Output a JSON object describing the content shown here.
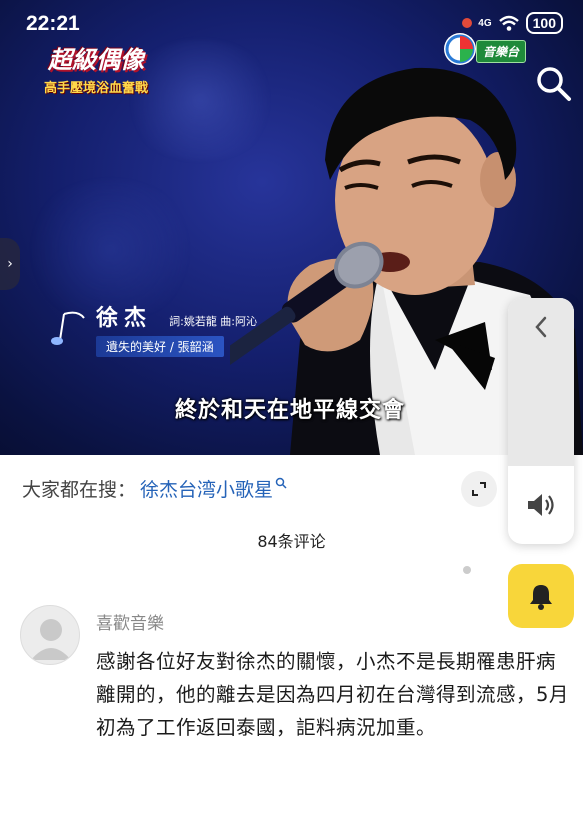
{
  "status_bar": {
    "time": "22:21",
    "network": "4G",
    "battery": "100"
  },
  "video": {
    "show_title": "超級偶像",
    "show_subtitle": "高手壓境浴血奮戰",
    "channel_badge": "音樂台",
    "singer_name": "徐杰",
    "credits": "詞:姚若龍 曲:阿沁",
    "song_title": "遺失的美好 / 張韶涵",
    "lyric_subtitle": "終於和天在地平線交會",
    "left_tab_glyph": "›"
  },
  "content": {
    "search_prefix": "大家都在搜：",
    "search_link": "徐杰台湾小歌星",
    "comment_count": "84条评论",
    "comment": {
      "user": "喜歡音樂",
      "text": "感謝各位好友對徐杰的關懷，小杰不是長期罹患肝病離開的，他的離去是因為四月初在台灣得到流感，5月初為了工作返回泰國，詎料病況加重。"
    }
  },
  "colors": {
    "link": "#2563b8",
    "bell_bg": "#f8d63a",
    "video_bg": "#141f6d"
  },
  "icons": [
    "search-icon",
    "chevron-left-icon",
    "speaker-icon",
    "bell-icon",
    "expand-icon",
    "avatar-icon",
    "music-note-icon",
    "chevron-right-icon"
  ]
}
